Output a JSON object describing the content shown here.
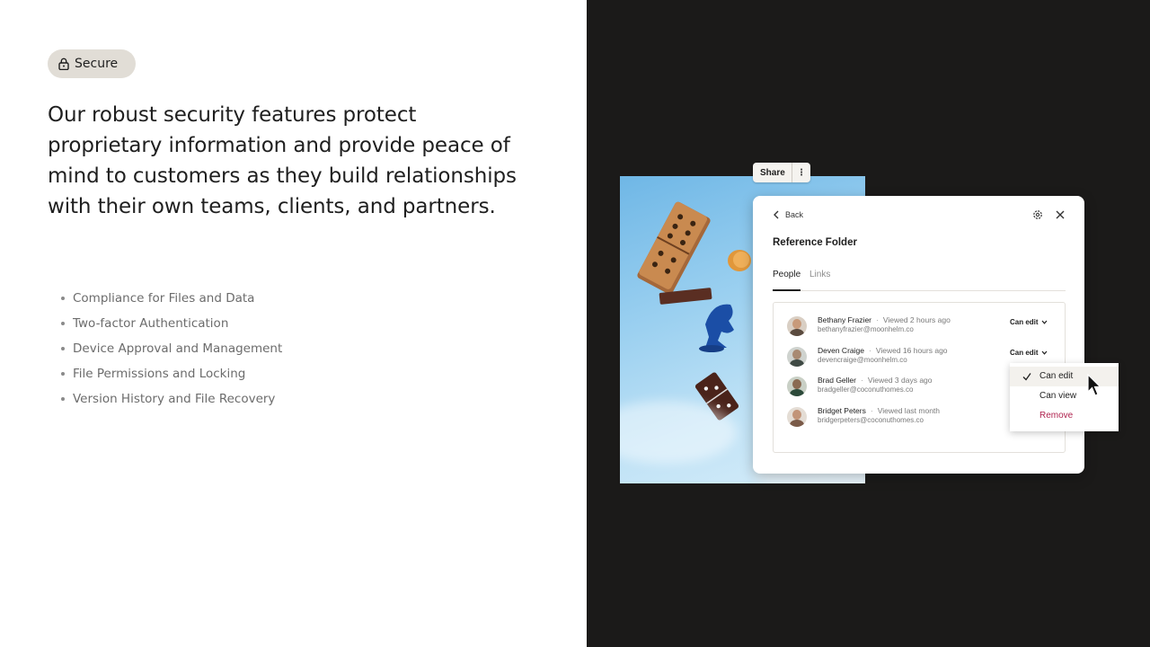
{
  "badge": {
    "label": "Secure",
    "icon": "lock-icon"
  },
  "headline": "Our robust security features protect\nproprietary information  and provide peace of\nmind to customers as they build relationships\nwith their own teams, clients, and partners.",
  "features": [
    "Compliance for Files and Data",
    "Two-factor Authentication",
    "Device Approval and Management",
    "File Permissions and Locking",
    "Version History and File Recovery"
  ],
  "share_chip": {
    "label": "Share",
    "more_icon": "more-vertical-icon"
  },
  "dialog": {
    "back_label": "Back",
    "title": "Reference Folder",
    "tabs": [
      "People",
      "Links"
    ],
    "active_tab": "People",
    "people": [
      {
        "name": "Bethany Frazier",
        "viewed": "Viewed 2 hours ago",
        "email": "bethanyfrazier@moonhelm.co",
        "permission": "Can edit"
      },
      {
        "name": "Deven Craige",
        "viewed": "Viewed 16 hours ago",
        "email": "devencraige@moonhelm.co",
        "permission": "Can edit"
      },
      {
        "name": "Brad Geller",
        "viewed": "Viewed 3 days ago",
        "email": "bradgeller@coconuthomes.co",
        "permission": ""
      },
      {
        "name": "Bridget Peters",
        "viewed": "Viewed last month",
        "email": "bridgerpeters@coconuthomes.co",
        "permission": ""
      }
    ]
  },
  "permission_menu": {
    "items": [
      "Can edit",
      "Can view",
      "Remove"
    ],
    "selected": "Can edit"
  },
  "colors": {
    "left_bg": "#ffffff",
    "right_bg": "#1b1a19",
    "badge_bg": "#e1ddd6",
    "remove": "#b0234f"
  }
}
